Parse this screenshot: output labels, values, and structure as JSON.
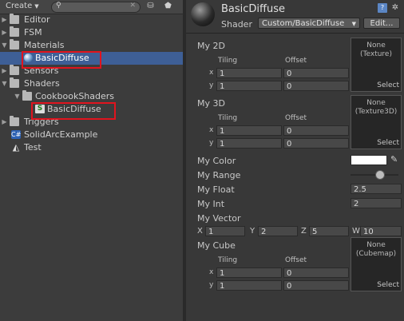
{
  "project": {
    "toolbar": {
      "create_label": "Create",
      "search_placeholder": ""
    },
    "tree": [
      {
        "label": "Editor",
        "icon": "folder-icon",
        "expanded": false
      },
      {
        "label": "FSM",
        "icon": "folder-icon",
        "expanded": false
      },
      {
        "label": "Materials",
        "icon": "folder-icon",
        "expanded": true
      },
      {
        "label": "BasicDiffuse",
        "icon": "material-sphere-icon",
        "selected": true
      },
      {
        "label": "Sensors",
        "icon": "folder-icon",
        "expanded": false
      },
      {
        "label": "Shaders",
        "icon": "folder-icon",
        "expanded": true
      },
      {
        "label": "CookbookShaders",
        "icon": "folder-icon",
        "expanded": true
      },
      {
        "label": "BasicDiffuse",
        "icon": "shader-icon"
      },
      {
        "label": "Triggers",
        "icon": "folder-icon",
        "expanded": false
      },
      {
        "label": "SolidArcExample",
        "icon": "csharp-script-icon"
      },
      {
        "label": "Test",
        "icon": "unity-scene-icon"
      }
    ]
  },
  "inspector": {
    "title": "BasicDiffuse",
    "shader_label": "Shader",
    "shader_value": "Custom/BasicDiffuse",
    "edit_label": "Edit...",
    "my2d": {
      "label": "My 2D",
      "tiling": "Tiling",
      "offset": "Offset",
      "x": "x",
      "y": "y",
      "tiling_x": "1",
      "offset_x": "0",
      "tiling_y": "1",
      "offset_y": "0",
      "tex_none": "None",
      "tex_type": "(Texture)",
      "select": "Select"
    },
    "my3d": {
      "label": "My 3D",
      "tiling": "Tiling",
      "offset": "Offset",
      "x": "x",
      "y": "y",
      "tiling_x": "1",
      "offset_x": "0",
      "tiling_y": "1",
      "offset_y": "0",
      "tex_none": "None",
      "tex_type": "(Texture3D)",
      "select": "Select"
    },
    "color": {
      "label": "My Color",
      "value": "#ffffff"
    },
    "range": {
      "label": "My Range",
      "level": 0.6
    },
    "float": {
      "label": "My Float",
      "value": "2.5"
    },
    "int": {
      "label": "My Int",
      "value": "2"
    },
    "vector": {
      "label": "My Vector",
      "x_lbl": "X",
      "x": "1",
      "y_lbl": "Y",
      "y": "2",
      "z_lbl": "Z",
      "z": "5",
      "w_lbl": "W",
      "w": "10"
    },
    "cube": {
      "label": "My Cube",
      "tiling": "Tiling",
      "offset": "Offset",
      "x": "x",
      "y": "y",
      "tiling_x": "1",
      "offset_x": "0",
      "tiling_y": "1",
      "offset_y": "0",
      "tex_none": "None",
      "tex_type": "(Cubemap)",
      "select": "Select"
    }
  },
  "colors": {
    "selection": "#3e5f96",
    "highlight": "#e0141e",
    "panel": "#383838"
  }
}
